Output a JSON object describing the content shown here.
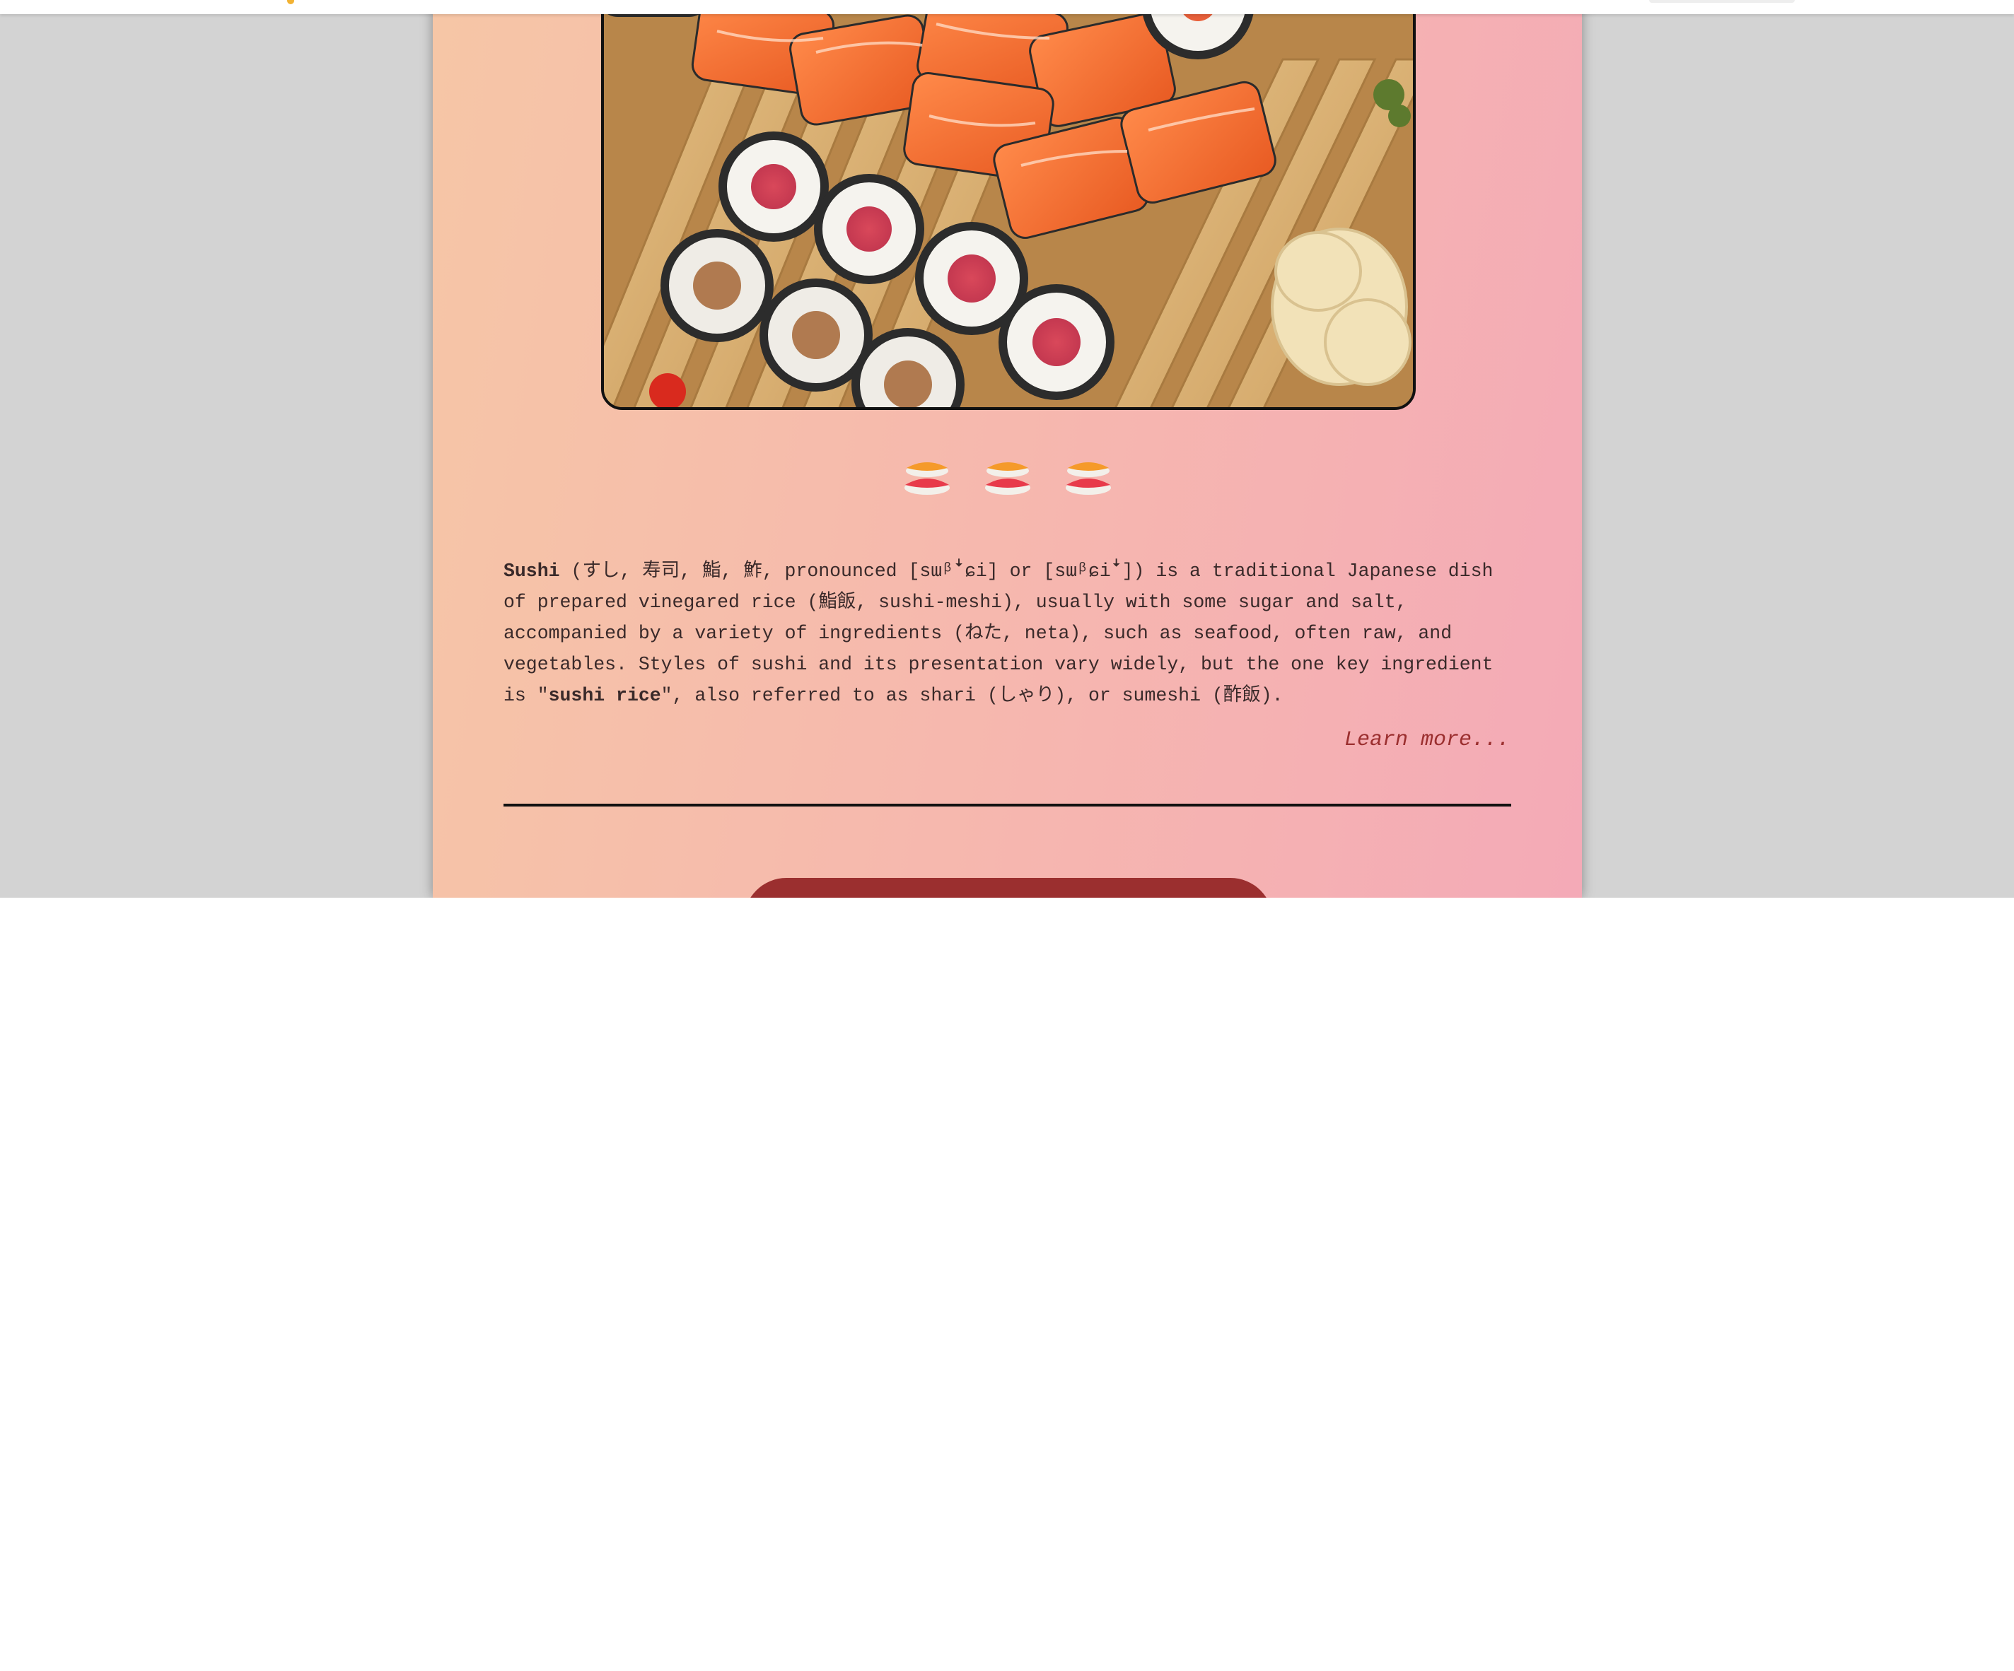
{
  "page": {
    "background": "#d3d3d3",
    "card_gradient": [
      "#f6c6a6",
      "#f4aab7"
    ],
    "accent_color": "#9b2f2f"
  },
  "hero_image": {
    "alt": "Sushi rolls on a wooden board"
  },
  "decoration": {
    "icon": "sushi-icon",
    "count": 3
  },
  "description": {
    "term": "Sushi",
    "part1": " (すし, 寿司, 鮨, 鮓, pronounced [sɯᵝꜜɕi] or [sɯᵝɕiꜜ]) is a traditional Japanese dish of prepared vinegared rice (鮨飯, sushi-meshi), usually with some sugar and salt, accompanied by a variety of ingredients (ねた, neta), such as seafood, often raw, and vegetables. Styles of sushi and its presentation vary widely, but the one key ingredient is \"",
    "emphasis": "sushi rice",
    "part2": "\", also referred to as shari (しゃり), or sumeshi (酢飯)."
  },
  "links": {
    "learn_more": "Learn more..."
  }
}
